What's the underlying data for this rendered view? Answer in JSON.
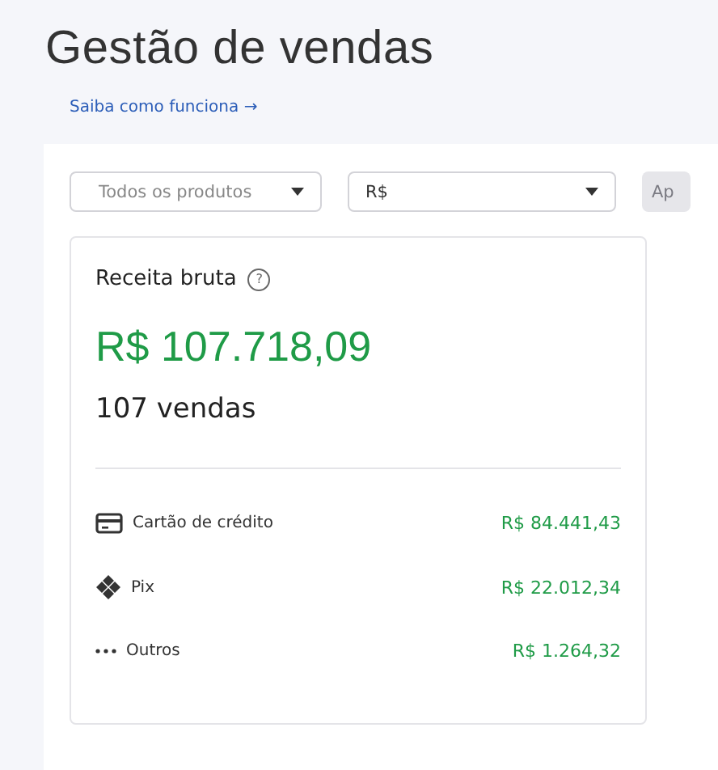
{
  "title": "Gestão de vendas",
  "link": {
    "label": "Saiba como funciona",
    "arrow": "→"
  },
  "filters": [
    {
      "kind": "placeholder",
      "text": "Todos os produtos"
    },
    {
      "kind": "value",
      "text": "R$"
    }
  ],
  "apply_button": {
    "label": "Ap",
    "disabled": true
  },
  "card": {
    "title": "Receita bruta",
    "help": "?",
    "total": "R$ 107.718,09",
    "sales": "107 vendas",
    "methods": [
      {
        "kind": "card",
        "label": "Cartão de crédito",
        "amount": "R$ 84.441,43"
      },
      {
        "kind": "pix",
        "label": "Pix",
        "amount": "R$ 22.012,34"
      },
      {
        "kind": "other",
        "label": "Outros",
        "amount": "R$ 1.264,32"
      }
    ]
  }
}
